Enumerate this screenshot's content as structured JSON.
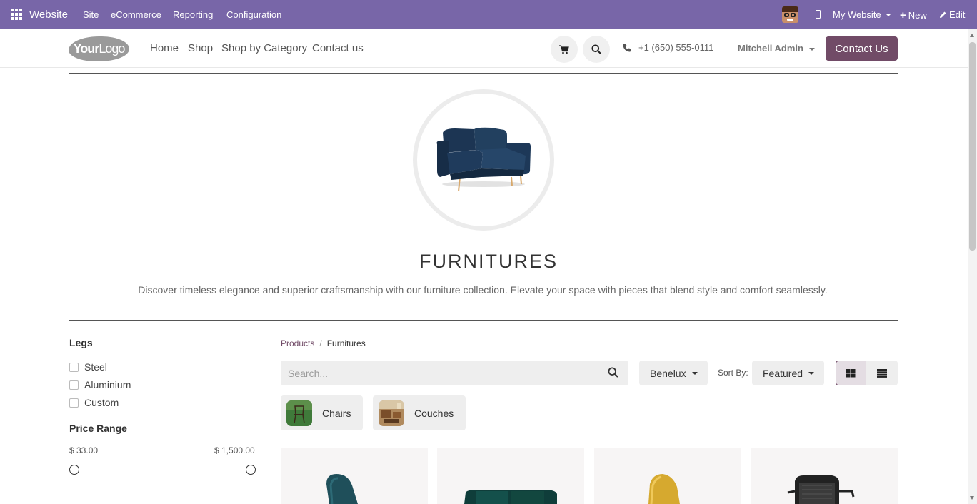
{
  "topbar": {
    "brand": "Website",
    "menu": [
      "Site",
      "eCommerce",
      "Reporting",
      "Configuration"
    ],
    "website_selector": "My Website",
    "new_label": "New",
    "edit_label": "Edit"
  },
  "header": {
    "logo_bold": "Your",
    "logo_thin": "Logo",
    "nav": [
      "Home",
      "Shop",
      "Shop by Category",
      "Contact us"
    ],
    "phone": "+1 (650) 555-0111",
    "user": "Mitchell Admin",
    "contact_button": "Contact Us"
  },
  "hero": {
    "title": "FURNITURES",
    "description": "Discover timeless elegance and superior craftsmanship with our furniture collection. Elevate your space with pieces that blend style and comfort seamlessly."
  },
  "filters": {
    "legs_title": "Legs",
    "legs_options": [
      "Steel",
      "Aluminium",
      "Custom"
    ],
    "price_title": "Price Range",
    "price_min": "$ 33.00",
    "price_max": "$ 1,500.00"
  },
  "breadcrumb": {
    "root": "Products",
    "separator": "/",
    "current": "Furnitures"
  },
  "toolbar": {
    "search_placeholder": "Search...",
    "pricelist": "Benelux",
    "sort_label": "Sort By:",
    "sort_value": "Featured"
  },
  "categories": [
    "Chairs",
    "Couches"
  ],
  "colors": {
    "topbar": "#7866a8",
    "brand_primary": "#714b67"
  }
}
